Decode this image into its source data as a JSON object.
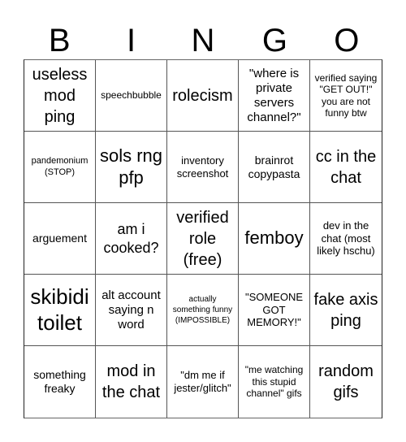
{
  "title_letters": [
    "B",
    "I",
    "N",
    "G",
    "O"
  ],
  "cells": [
    "useless mod ping",
    "speechbubble",
    "rolecism",
    "\"where is private servers channel?\"",
    "verified saying \"GET OUT!\" you are not funny btw",
    "pandemonium (STOP)",
    "sols rng pfp",
    "inventory screenshot",
    "brainrot copypasta",
    "cc in the chat",
    "arguement",
    "am i cooked?",
    "verified role (free)",
    "femboy",
    "dev in the chat (most likely hschu)",
    "skibidi toilet",
    "alt account saying n word",
    "actually something funny (IMPOSSIBLE)",
    "\"SOMEONE GOT MEMORY!\"",
    "fake axis ping",
    "something freaky",
    "mod in the chat",
    "\"dm me if jester/glitch\"",
    "\"me watching this stupid channel\" gifs",
    "random gifs"
  ]
}
